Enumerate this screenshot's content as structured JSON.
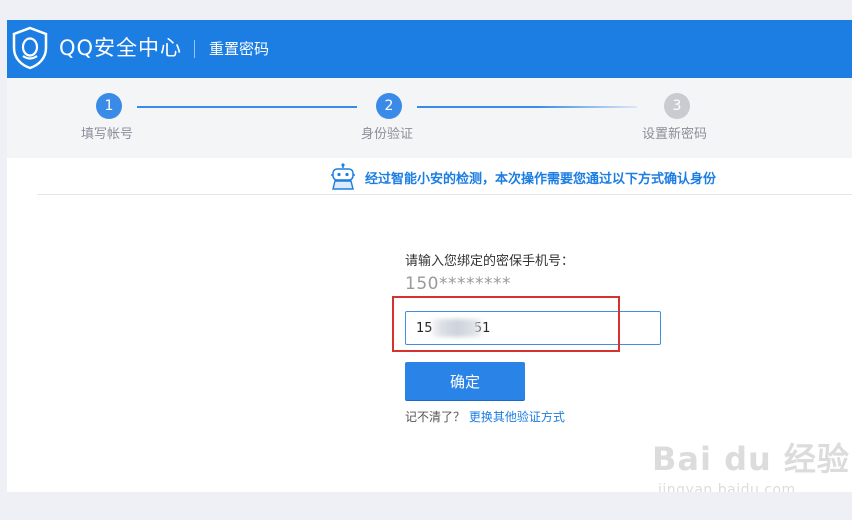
{
  "header": {
    "brand": "QQ安全中心",
    "subtitle": "重置密码",
    "background_color": "#1c7de3"
  },
  "steps": [
    {
      "number": "1",
      "label": "填写帐号",
      "state": "completed"
    },
    {
      "number": "2",
      "label": "身份验证",
      "state": "active"
    },
    {
      "number": "3",
      "label": "设置新密码",
      "state": "pending"
    }
  ],
  "notice": {
    "icon": "robot-icon",
    "text": "经过智能小安的检测，本次操作需要您通过以下方式确认身份"
  },
  "form": {
    "label": "请输入您绑定的密保手机号：",
    "masked_phone": "150********",
    "input_value": "15          51",
    "confirm_label": "确定",
    "forgot_prefix": "记不清了？",
    "forgot_link": "更换其他验证方式"
  },
  "watermark": {
    "main": "Bai du 经验",
    "sub": "jingyan.baidu.com"
  },
  "colors": {
    "accent": "#1c7de3",
    "highlight": "#d6322f",
    "step_pending": "#c8cbd0"
  }
}
